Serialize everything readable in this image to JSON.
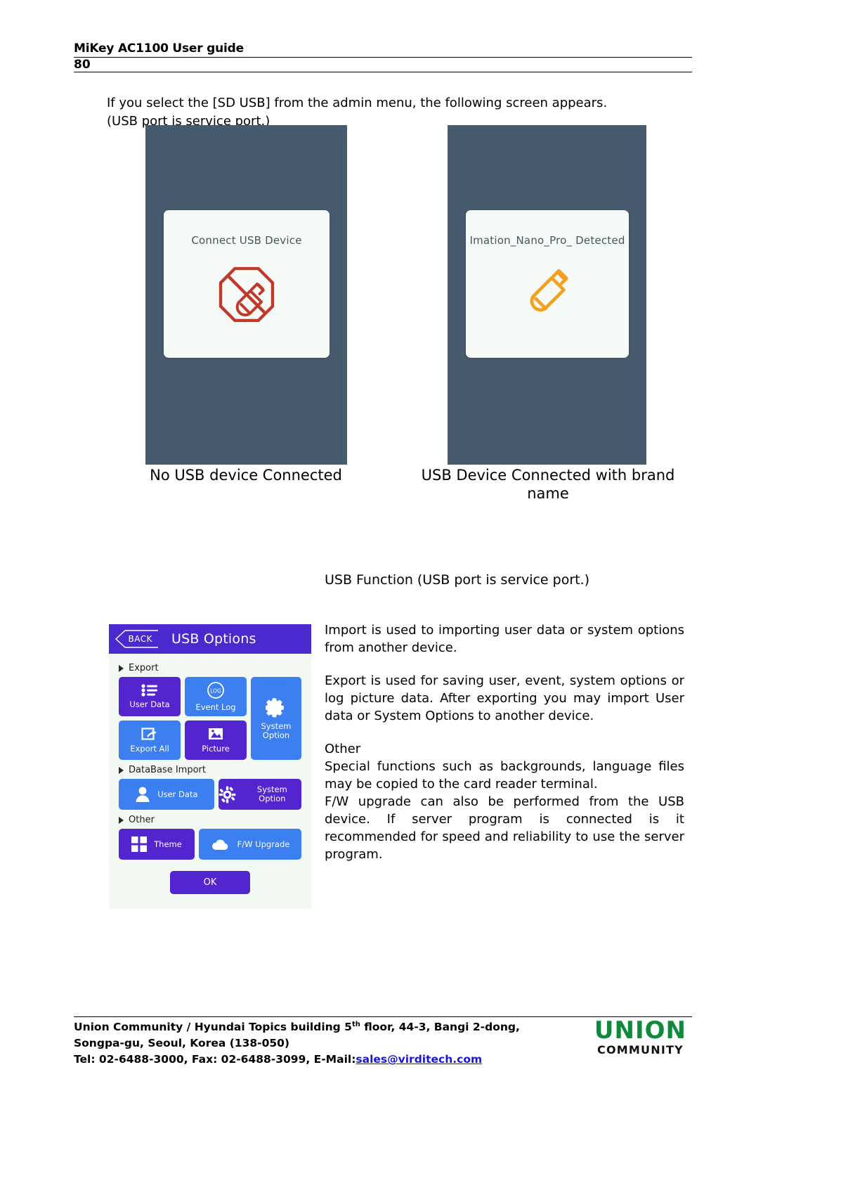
{
  "header": {
    "doc_title": "MiKey AC1100 User guide",
    "page_number": "80"
  },
  "intro": {
    "line1": "If you select the [SD USB] from the admin menu, the following screen appears.",
    "line2": "(USB port is service port.)"
  },
  "device_screens": [
    {
      "id": "no-usb",
      "card_label": "Connect USB Device",
      "icon": "usb-disconnected-icon",
      "icon_color": "#c0392b",
      "caption": "No USB device Connected",
      "background": "#475a6e"
    },
    {
      "id": "usb-detected",
      "card_label": "Imation_Nano_Pro_ Detected",
      "icon": "usb-drive-icon",
      "icon_color": "#f5a01e",
      "caption": "USB Device Connected with brand name",
      "background": "#475a6e"
    }
  ],
  "usb_options": {
    "back_label": "BACK",
    "title": "USB Options",
    "header_color": "#4a29cf",
    "sections": [
      {
        "title": "Export",
        "buttons": [
          {
            "label": "User Data",
            "icon": "list-icon",
            "color": "#5325cf"
          },
          {
            "label": "Event Log",
            "icon": "log-circle-icon",
            "color": "#3b7ff0"
          },
          {
            "label": "System Option",
            "icon": "gear-icon",
            "color": "#3b7ff0"
          },
          {
            "label": "Export All",
            "icon": "export-arrow-icon",
            "color": "#3b7ff0"
          },
          {
            "label": "Picture",
            "icon": "image-icon",
            "color": "#5325cf"
          }
        ]
      },
      {
        "title": "DataBase Import",
        "buttons": [
          {
            "label": "User Data",
            "icon": "person-icon",
            "color": "#3b7ff0"
          },
          {
            "label": "System Option",
            "icon": "gear-icon",
            "color": "#5325cf"
          }
        ]
      },
      {
        "title": "Other",
        "buttons": [
          {
            "label": "Theme",
            "icon": "grid-icon",
            "color": "#5325cf"
          },
          {
            "label": "F/W Upgrade",
            "icon": "cloud-upload-icon",
            "color": "#3b7ff0"
          }
        ]
      }
    ],
    "ok_label": "OK"
  },
  "body": {
    "heading": "USB Function (USB port is service port.)",
    "para_import": "Import is used to importing user data or system options from another device.",
    "para_export": "Export is used for saving user, event, system options or log picture data. After exporting you may import User data or System Options to another device.",
    "other_heading": "Other",
    "para_other1": "Special functions such as backgrounds, language files may be copied to the card reader terminal.",
    "para_other2": "F/W upgrade can also be performed from the USB device. If server program is connected is it recommended for speed and reliability to use the server program."
  },
  "footer": {
    "line1_a": "Union Community / Hyundai Topics building 5",
    "line1_sup": "th",
    "line1_b": " floor, 44-3, Bangi 2-dong,",
    "line2": "Songpa-gu, Seoul, Korea (138-050)",
    "line3_a": "Tel: 02-6488-3000, Fax: 02-6488-3099, E-Mail:",
    "email": "sales@virditech.com",
    "logo_mark": "UNION",
    "logo_sub": "COMMUNITY",
    "logo_color": "#0f8a3c"
  }
}
